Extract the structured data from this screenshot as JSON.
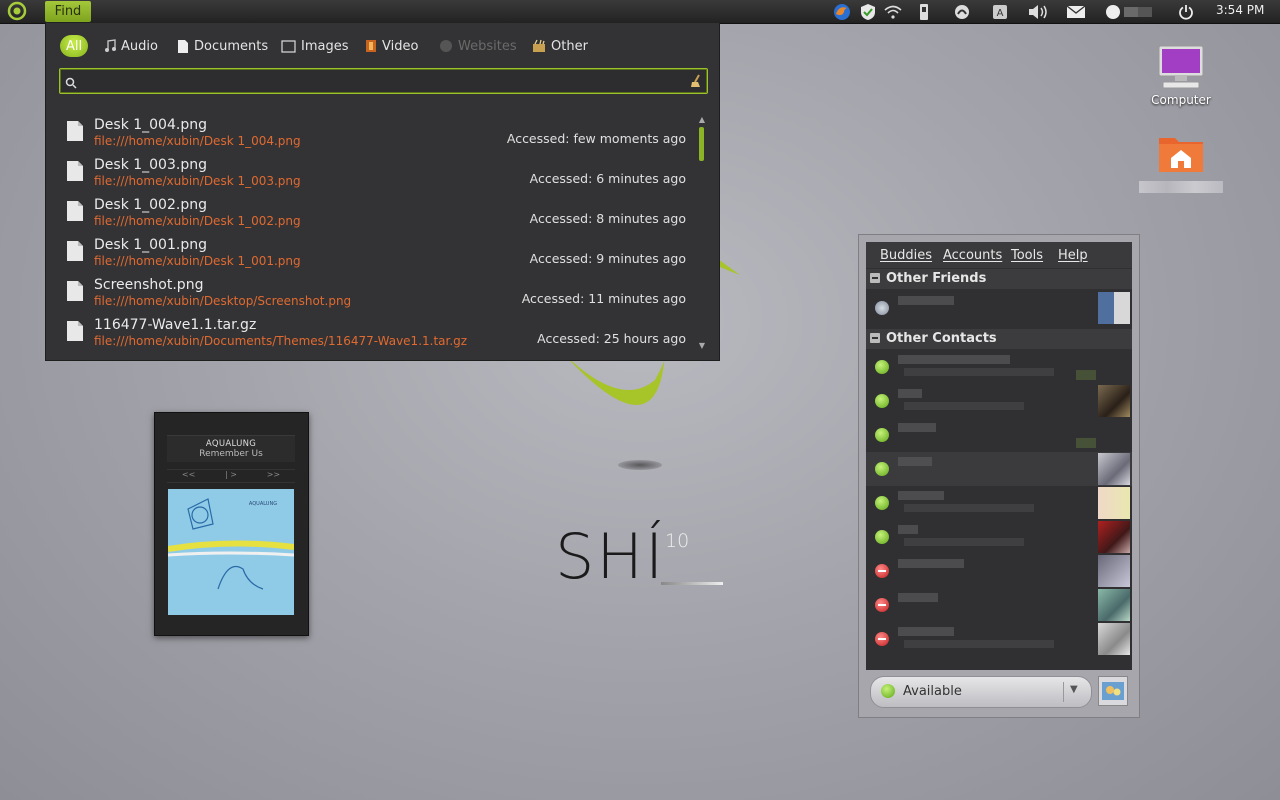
{
  "panel": {
    "find_label": "Find",
    "clock": "3:54 PM",
    "tray_icons": [
      "firefox-icon",
      "shield-icon",
      "wifi-icon",
      "usb-icon",
      "update-icon",
      "keyboard-icon",
      "volume-icon",
      "mail-icon",
      "user-icon",
      "power-icon"
    ]
  },
  "find": {
    "tabs": [
      {
        "label": "All",
        "icon": "all"
      },
      {
        "label": "Audio",
        "icon": "music-note-icon"
      },
      {
        "label": "Documents",
        "icon": "document-icon"
      },
      {
        "label": "Images",
        "icon": "image-icon"
      },
      {
        "label": "Video",
        "icon": "film-icon"
      },
      {
        "label": "Websites",
        "icon": "globe-icon"
      },
      {
        "label": "Other",
        "icon": "box-icon"
      }
    ],
    "search_value": "",
    "results": [
      {
        "name": "Desk 1_004.png",
        "path": "file:///home/xubin/Desk 1_004.png",
        "accessed": "Accessed: few moments ago"
      },
      {
        "name": "Desk 1_003.png",
        "path": "file:///home/xubin/Desk 1_003.png",
        "accessed": "Accessed: 6 minutes ago"
      },
      {
        "name": "Desk 1_002.png",
        "path": "file:///home/xubin/Desk 1_002.png",
        "accessed": "Accessed: 8 minutes ago"
      },
      {
        "name": "Desk 1_001.png",
        "path": "file:///home/xubin/Desk 1_001.png",
        "accessed": "Accessed: 9 minutes ago"
      },
      {
        "name": "Screenshot.png",
        "path": "file:///home/xubin/Desktop/Screenshot.png",
        "accessed": "Accessed: 11 minutes ago"
      },
      {
        "name": "116477-Wave1.1.tar.gz",
        "path": "file:///home/xubin/Documents/Themes/116477-Wave1.1.tar.gz",
        "accessed": "Accessed: 25 hours ago"
      }
    ],
    "scroll_fraction": 0.12
  },
  "desktop": {
    "computer_label": "Computer",
    "behind_label": "Screenshot.png"
  },
  "player": {
    "artist": "AQUALUNG",
    "track": "Remember Us",
    "prev": "<<",
    "play": "| >",
    "next": ">>",
    "art_text": "AQUALUNG"
  },
  "logo": {
    "text": "SHÍ",
    "version": "10"
  },
  "buddy": {
    "menu": [
      "Buddies",
      "Accounts",
      "Tools",
      "Help"
    ],
    "groups": [
      {
        "label": "Other Friends"
      },
      {
        "label": "Other Contacts"
      }
    ],
    "status_label": "Available",
    "colors": {
      "accent": "#8bb426",
      "path": "#e06a30",
      "online": "#5ea718",
      "busy": "#c31d1d"
    }
  }
}
